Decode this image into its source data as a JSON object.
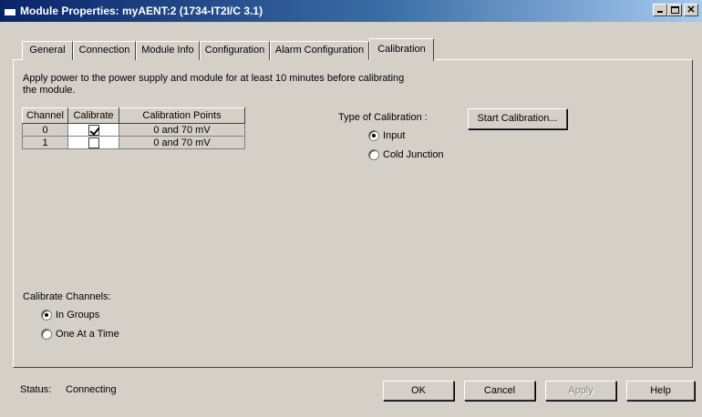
{
  "window": {
    "title": "Module Properties: myAENT:2 (1734-IT2I/C 3.1)"
  },
  "tabs": [
    {
      "label": "General"
    },
    {
      "label": "Connection"
    },
    {
      "label": "Module Info"
    },
    {
      "label": "Configuration"
    },
    {
      "label": "Alarm Configuration"
    },
    {
      "label": "Calibration"
    }
  ],
  "active_tab": "Calibration",
  "calibration": {
    "instruction": "Apply power to the power supply and module for at least 10 minutes before calibrating the module.",
    "table": {
      "headers": [
        "Channel",
        "Calibrate",
        "Calibration Points"
      ],
      "rows": [
        {
          "channel": "0",
          "calibrate": true,
          "points": "0 and 70 mV"
        },
        {
          "channel": "1",
          "calibrate": false,
          "points": "0 and 70 mV"
        }
      ]
    },
    "type_label": "Type of Calibration :",
    "type_options": [
      {
        "label": "Input",
        "selected": true
      },
      {
        "label": "Cold Junction",
        "selected": false
      }
    ],
    "start_button": "Start Calibration...",
    "channels_label": "Calibrate Channels:",
    "channel_options": [
      {
        "label": "In Groups",
        "selected": true
      },
      {
        "label": "One At a Time",
        "selected": false
      }
    ]
  },
  "status": {
    "label": "Status:",
    "value": "Connecting"
  },
  "buttons": {
    "ok": "OK",
    "cancel": "Cancel",
    "apply": "Apply",
    "help": "Help"
  }
}
